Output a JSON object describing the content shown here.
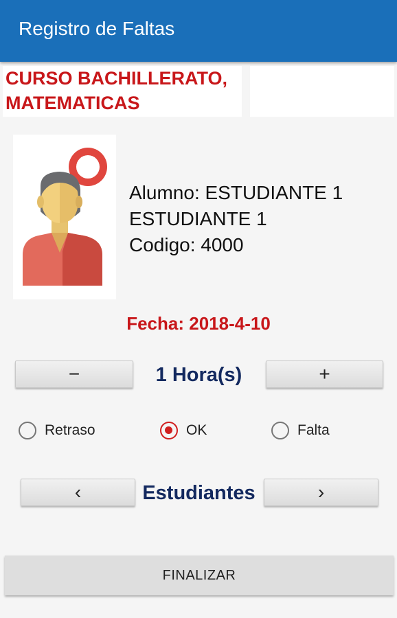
{
  "appbar": {
    "title": "Registro de Faltas"
  },
  "course": {
    "text": "CURSO BACHILLERATO,\n MATEMATICAS"
  },
  "student": {
    "line1": "Alumno: ESTUDIANTE 1",
    "line2": "ESTUDIANTE 1",
    "line3": "Codigo: 4000",
    "avatar_icon": "student-avatar-icon"
  },
  "fecha": "Fecha: 2018-4-10",
  "hours": {
    "minus_label": "−",
    "value": "1 Hora(s)",
    "plus_label": "+"
  },
  "attendance": {
    "options": [
      {
        "label": "Retraso",
        "checked": false
      },
      {
        "label": "OK",
        "checked": true
      },
      {
        "label": "Falta",
        "checked": false
      }
    ]
  },
  "navigation": {
    "prev_label": "‹",
    "label": "Estudiantes",
    "next_label": "›"
  },
  "finalizar_label": "FINALIZAR",
  "colors": {
    "appbar": "#1a6fb9",
    "accent_red": "#c8171a",
    "navy": "#13295f"
  }
}
